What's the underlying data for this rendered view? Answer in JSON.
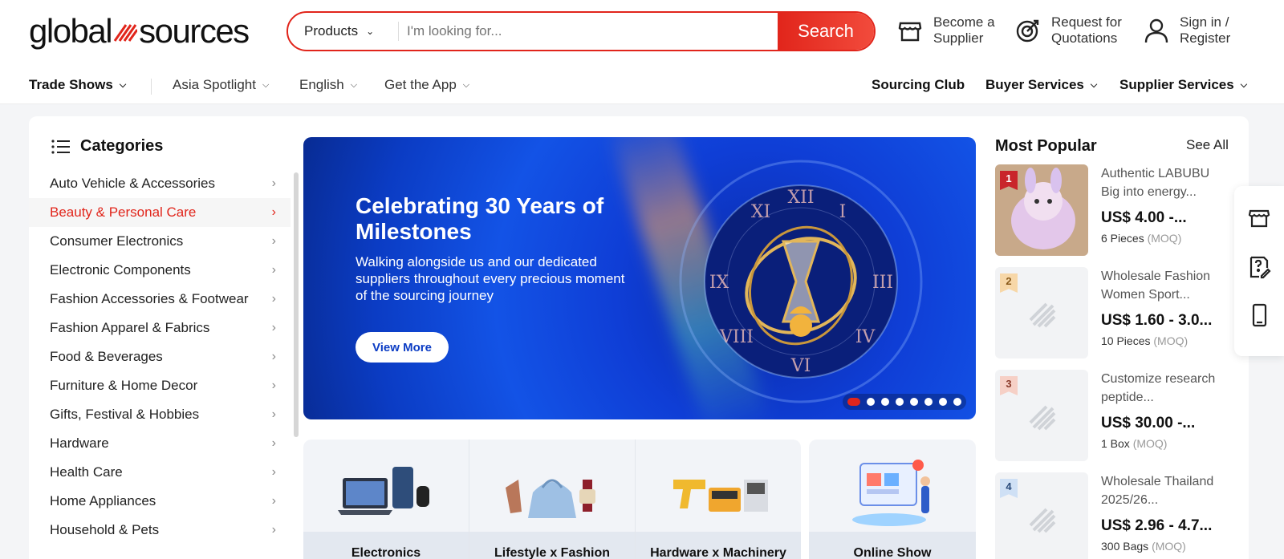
{
  "header": {
    "logo_text_1": "global",
    "logo_text_2": "sources",
    "search": {
      "category": "Products",
      "placeholder": "I'm looking for...",
      "button": "Search"
    },
    "actions": [
      {
        "line1": "Become a",
        "line2": "Supplier",
        "icon": "store-icon"
      },
      {
        "line1": "Request for",
        "line2": "Quotations",
        "icon": "target-icon"
      },
      {
        "line1": "Sign in /",
        "line2": "Register",
        "icon": "user-icon"
      }
    ]
  },
  "nav": {
    "trade_shows": "Trade Shows",
    "asia_spotlight": "Asia Spotlight",
    "english": "English",
    "get_app": "Get the App",
    "sourcing_club": "Sourcing Club",
    "buyer_services": "Buyer Services",
    "supplier_services": "Supplier Services"
  },
  "categories": {
    "title": "Categories",
    "items": [
      "Auto Vehicle & Accessories",
      "Beauty & Personal Care",
      "Consumer Electronics",
      "Electronic Components",
      "Fashion Accessories & Footwear",
      "Fashion Apparel & Fabrics",
      "Food & Beverages",
      "Furniture & Home Decor",
      "Gifts, Festival & Hobbies",
      "Hardware",
      "Health Care",
      "Home Appliances",
      "Household & Pets"
    ],
    "active_index": 1
  },
  "banner": {
    "title": "Celebrating 30 Years of Milestones",
    "subtitle": "Walking alongside us and our dedicated suppliers throughout every precious moment of the sourcing journey",
    "button": "View More",
    "slide_count": 8,
    "active_slide": 0
  },
  "tiles": [
    "Electronics",
    "Lifestyle x Fashion",
    "Hardware x Machinery",
    "Online Show"
  ],
  "popular": {
    "title": "Most Popular",
    "see_all": "See All",
    "items": [
      {
        "rank": "1",
        "name": "Authentic LABUBU Big into energy...",
        "price": "US$ 4.00 -...",
        "moq_qty": "6 Pieces",
        "moq_label": "(MOQ)"
      },
      {
        "rank": "2",
        "name": "Wholesale Fashion Women Sport...",
        "price": "US$ 1.60 - 3.0...",
        "moq_qty": "10 Pieces",
        "moq_label": "(MOQ)"
      },
      {
        "rank": "3",
        "name": "Customize research peptide...",
        "price": "US$ 30.00 -...",
        "moq_qty": "1 Box",
        "moq_label": "(MOQ)"
      },
      {
        "rank": "4",
        "name": "Wholesale Thailand 2025/26...",
        "price": "US$ 2.96 - 4.7...",
        "moq_qty": "300 Bags",
        "moq_label": "(MOQ)"
      }
    ]
  },
  "colors": {
    "brand_red": "#e1251b",
    "banner_blue": "#0b3cc4"
  }
}
